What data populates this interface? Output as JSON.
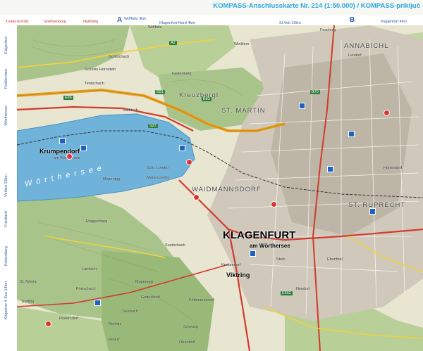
{
  "header": {
    "title": "KOMPASS-Anschlusskarte Nr. 214 (1:50.000) / KOMPASS-priključ"
  },
  "frame": {
    "grid_letters": [
      "A",
      "B"
    ],
    "edge_notes_top": [
      "Turkenschütz",
      "Greifsenburg",
      "Nußberg",
      "Wölfnitz 3km",
      "Klagenfurt-Nord 4km",
      "St.Veit 16km",
      "Klagenfurt 4km"
    ],
    "edge_notes_left": [
      "Klagenfurt",
      "Feldkirchen",
      "Wörthersee",
      "Velden 13km",
      "Friedlach",
      "Köstenberg",
      "Klopeiner 4 See 14km"
    ]
  },
  "map": {
    "cities": {
      "main": "KLAGENFURT",
      "main_sub": "am Wörthersee"
    },
    "towns": [
      "Krumpendorf",
      "Viktring"
    ],
    "town_subs": [
      "am Wörthersee"
    ],
    "districts": [
      "Kreuzbergl",
      "ST. MARTIN",
      "WAIDMANNSDORF",
      "ST. RUPRECHT",
      "ANNABICHL"
    ],
    "lake": "Wörthersee",
    "places": [
      "Wölfnitz",
      "Goritschach",
      "Falkenberg",
      "Gurlitsch",
      "Schloss Hornstein",
      "Tentschach",
      "Majernigg",
      "Schl. Loretto",
      "Maria Loretto",
      "Roggenberg",
      "Reifnitz",
      "St. Nikola",
      "Lambichl",
      "Feschnig",
      "Winklern",
      "Köttmannsdorf",
      "Krottendorf",
      "Mageregg",
      "Ebenthal",
      "Pörtschach",
      "Seebach",
      "Reauz",
      "Schwaig",
      "Trettnig",
      "Rudersdorf",
      "Suetschach",
      "Oberdörfl",
      "Lendorf",
      "Hörtendorf",
      "Stein",
      "Neudorf",
      "Gottesbichl"
    ],
    "roads": [
      "A2",
      "B83",
      "B91",
      "B70",
      "S37",
      "E66",
      "E652"
    ],
    "colors": {
      "lake": "#6fb2da",
      "forest": "#a9c48a",
      "field": "#e8e5d1",
      "urban": "#c9c3b6",
      "motorway": "#e8a21e",
      "main_road": "#d33a2c",
      "secondary": "#f0d23c",
      "frame": "#2b5ea8",
      "accent": "#2aa7e0"
    }
  }
}
